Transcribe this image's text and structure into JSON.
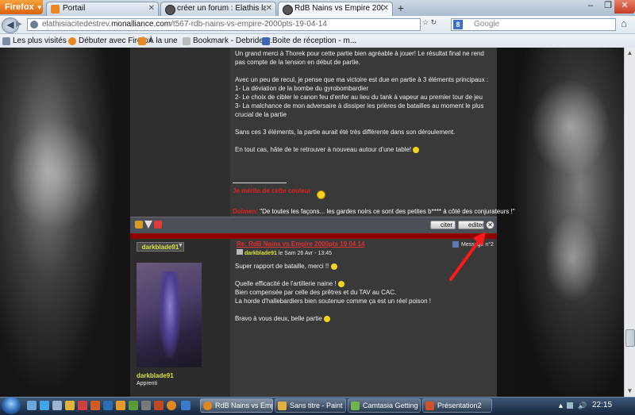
{
  "browser": {
    "app_menu": "Firefox",
    "tabs": [
      {
        "label": "Portail",
        "icon": "orange-page-icon"
      },
      {
        "label": "créer un forum : Elathis la Cité des Tr...",
        "icon": "forumactif-icon"
      },
      {
        "label": "RdB Nains vs Empire 2000pts 19 04 14",
        "icon": "forumactif-icon"
      }
    ],
    "url_prefix": "elathisiacitedestrev.",
    "url_domain": "monalliance.com",
    "url_path": "/t567-rdb-nains-vs-empire-2000pts-19-04-14",
    "search_placeholder": "Google",
    "bookmarks": [
      "Les plus visités",
      "Débuter avec Firefox",
      "À la une",
      "Bookmark - Debrideur...",
      "Boite de réception - m..."
    ]
  },
  "post1": {
    "paragraphs": [
      "Un grand merci à Thorek pour cette partie bien agréable à jouer! Le résultat final ne rend pas compte de la tension en début de partie.",
      "Avec un peu de recul, je pense que ma victoire est due en partie à 3 éléments principaux :",
      "1- La déviation de la bombe du gyrobombardier",
      "2- Le choix de cibler le canon feu d'enfer au lieu du tank à vapeur au premier tour de jeu",
      "3- La malchance de mon adversaire à dissiper les prières de batailles au moment le plus crucial de la partie",
      "Sans ces 3 éléments, la partie aurait été très différente dans son déroulement.",
      "En tout cas, hâte de te retrouver à nouveau autour d'une table!"
    ],
    "signature_line1": "Je mérite de cette couleur",
    "signature_label": "Dolmen:",
    "signature_quote": "\"De toutes les façons... les gardes noirs ce sont des petites b**** à côté des conjurateurs !\""
  },
  "toolbar": {
    "quote_label": "citer",
    "edit_label": "editer"
  },
  "post2": {
    "username": "darkblade91",
    "title": "Re: RdB Nains vs Empire 2000pts 19 04 14",
    "author": "darkblade91",
    "date": "le Sam 26 Avr - 13:45",
    "message_number": "Message n°2",
    "paragraphs": [
      "Super rapport de bataille, merci !!",
      "Quelle efficacité de l'artillerie naine !",
      "Bien compensée par celle des prêtres et du TAV au CAC.",
      "La horde d'hallebardiers bien soutenue comme ça est un réel poison !",
      "Bravo à vous deux, belle partie"
    ],
    "rank": "Apprenti"
  },
  "taskbar": {
    "tasks": [
      {
        "label": "RdB Nains vs Empir...",
        "active": true
      },
      {
        "label": "Sans titre - Paint",
        "active": false
      },
      {
        "label": "Camtasia Getting St...",
        "active": false
      },
      {
        "label": "Présentation2",
        "active": false
      }
    ],
    "clock": "22:15"
  },
  "colors": {
    "accent_red": "#8f0000",
    "username_yellow": "#d9e23a",
    "link_red": "#e03030"
  }
}
